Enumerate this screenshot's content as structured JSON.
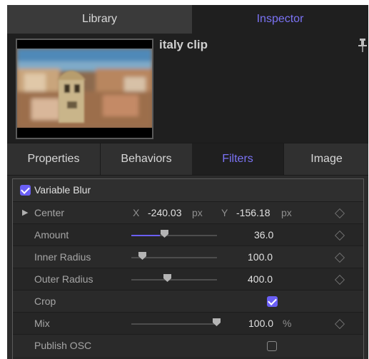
{
  "top_tabs": {
    "library": "Library",
    "inspector": "Inspector"
  },
  "header": {
    "clip_name": "italy clip",
    "pin_icon": "pin-icon"
  },
  "sub_tabs": {
    "properties": "Properties",
    "behaviors": "Behaviors",
    "filters": "Filters",
    "image": "Image"
  },
  "filter": {
    "name": "Variable Blur",
    "enabled": true,
    "center": {
      "label": "Center",
      "x_label": "X",
      "x_value": "-240.03",
      "x_unit": "px",
      "y_label": "Y",
      "y_value": "-156.18",
      "y_unit": "px"
    },
    "amount": {
      "label": "Amount",
      "value": "36.0",
      "slider_fraction": 0.36
    },
    "inner_radius": {
      "label": "Inner Radius",
      "value": "100.0",
      "slider_fraction": 0.1
    },
    "outer_radius": {
      "label": "Outer Radius",
      "value": "400.0",
      "slider_fraction": 0.4
    },
    "crop": {
      "label": "Crop",
      "checked": true
    },
    "mix": {
      "label": "Mix",
      "value": "100.0",
      "unit": "%",
      "slider_fraction": 1.0
    },
    "publish_osc": {
      "label": "Publish OSC",
      "checked": false
    }
  },
  "colors": {
    "accent": "#6a5ff5",
    "panel_bg": "#2b2b2b",
    "active_tab": "#7b73f5"
  }
}
